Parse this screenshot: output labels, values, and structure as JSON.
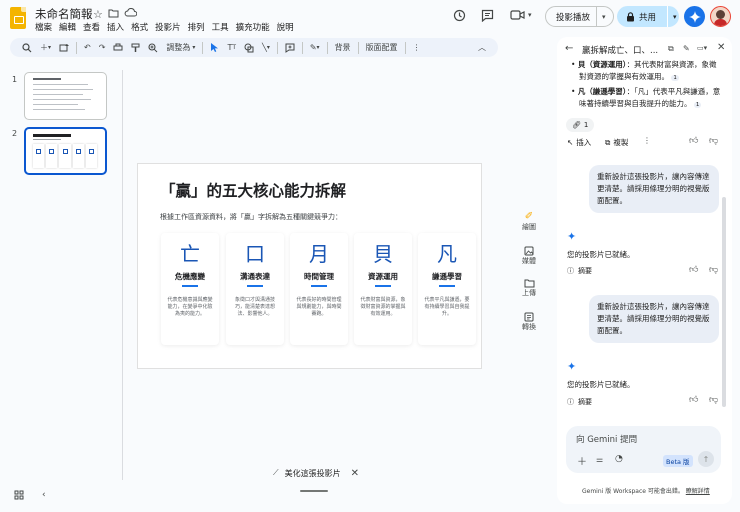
{
  "doc": {
    "title": "未命名簡報"
  },
  "menu": [
    "檔案",
    "編輯",
    "查看",
    "插入",
    "格式",
    "投影片",
    "排列",
    "工具",
    "擴充功能",
    "說明"
  ],
  "header": {
    "slideshow_label": "投影播放",
    "share_label": "共用"
  },
  "toolbar": {
    "zoom_label": "調整為",
    "bg_label": "背景",
    "layout_label": "版面配置"
  },
  "filmstrip": [
    {
      "num": "1"
    },
    {
      "num": "2"
    }
  ],
  "slide": {
    "title": "「贏」的五大核心能力拆解",
    "subtitle": "根據工作區資源資料，將「贏」字拆解為五種關鍵競爭力：",
    "cards": [
      {
        "glyph": "亡",
        "heading": "危機應變",
        "desc": "代表危機意識與應變能力，在變爭中化險為夷的能力。"
      },
      {
        "glyph": "口",
        "heading": "溝通表達",
        "desc": "象徵口才與溝通技巧，能清楚表達想法、影響他人。"
      },
      {
        "glyph": "月",
        "heading": "時間管理",
        "desc": "代表長好的時間管理與規劃能力，與時間賽跑。"
      },
      {
        "glyph": "貝",
        "heading": "資源運用",
        "desc": "代表財富與資源，象徵財富資源的掌握與有效運用。"
      },
      {
        "glyph": "凡",
        "heading": "謙遜學習",
        "desc": "代表平凡與謙遜，要有持續學習與自我提升。"
      }
    ]
  },
  "side_tools": [
    {
      "label": "繪圖"
    },
    {
      "label": "媒體"
    },
    {
      "label": "上傳"
    },
    {
      "label": "轉換"
    }
  ],
  "bottom": {
    "beautify_label": "美化這張投影片"
  },
  "gemini": {
    "panel_title": "贏拆解成亡、口、...",
    "items": [
      {
        "bold": "貝（資源運用）",
        "text": "：其代表財富與資源，象徵對資源的掌握與有效運用。",
        "ref": "1"
      },
      {
        "bold": "凡（謙遜學習）",
        "text": "：「凡」代表平凡與謙遜，意味著持續學習與自我提升的能力。",
        "ref": "1"
      }
    ],
    "source_count": "1",
    "insert_label": "插入",
    "copy_label": "複製",
    "prompt": "重新設計這張投影片，讓內容傳達更清楚。請採用條理分明的視覺版面配置。",
    "reply": "您的投影片已就緒。",
    "summary_label": "摘要",
    "input_placeholder": "向 Gemini 提問",
    "beta_label": "Beta 版",
    "disclaimer": "Gemini 版 Workspace 可能會出錯。",
    "disclaimer_link": "瞭解詳情"
  },
  "colors": {
    "accent": "#1a73e8",
    "share_bg": "#c2e7ff",
    "title_accent": "#1a56b5"
  }
}
